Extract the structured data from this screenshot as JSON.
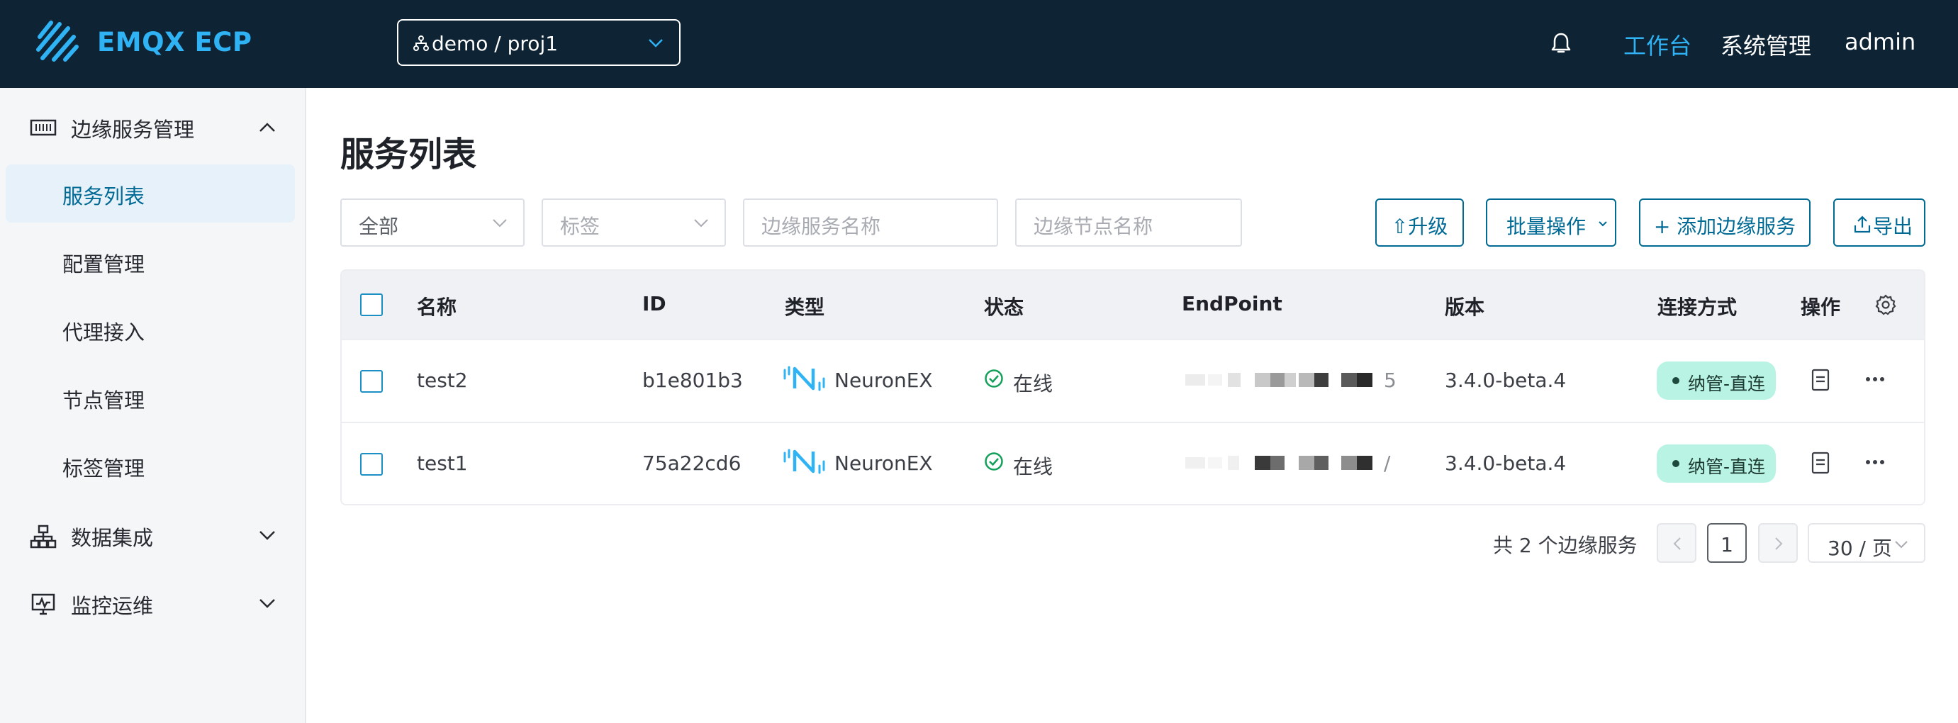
{
  "header": {
    "brand": "EMQX ECP",
    "project_selector": "demo / proj1",
    "nav": {
      "workbench": "工作台",
      "system": "系统管理",
      "user": "admin"
    }
  },
  "sidebar": {
    "groups": [
      {
        "label": "边缘服务管理",
        "expanded": true,
        "icon": "barcode-icon"
      },
      {
        "label": "数据集成",
        "expanded": false,
        "icon": "sitemap-icon"
      },
      {
        "label": "监控运维",
        "expanded": false,
        "icon": "monitor-icon"
      }
    ],
    "items": [
      {
        "label": "服务列表",
        "active": true
      },
      {
        "label": "配置管理",
        "active": false
      },
      {
        "label": "代理接入",
        "active": false
      },
      {
        "label": "节点管理",
        "active": false
      },
      {
        "label": "标签管理",
        "active": false
      }
    ]
  },
  "main": {
    "title": "服务列表",
    "filters": {
      "type_select": "全部",
      "tag_select_placeholder": "标签",
      "service_name_placeholder": "边缘服务名称",
      "node_name_placeholder": "边缘节点名称"
    },
    "actions": {
      "upgrade": "⇧升级",
      "batch": "批量操作",
      "add": "+ 添加边缘服务",
      "export": "导出"
    },
    "table": {
      "columns": [
        "名称",
        "ID",
        "类型",
        "状态",
        "EndPoint",
        "版本",
        "连接方式",
        "操作"
      ],
      "rows": [
        {
          "name": "test2",
          "id": "b1e801b3",
          "type": "NeuronEX",
          "status": "在线",
          "endpoint_trailing": "5",
          "version": "3.4.0-beta.4",
          "connection": "纳管-直连"
        },
        {
          "name": "test1",
          "id": "75a22cd6",
          "type": "NeuronEX",
          "status": "在线",
          "endpoint_trailing": "/",
          "version": "3.4.0-beta.4",
          "connection": "纳管-直连"
        }
      ]
    },
    "pagination": {
      "total_text": "共 2 个边缘服务",
      "current_page": "1",
      "page_size": "30 / 页"
    }
  },
  "colors": {
    "header_bg": "#0e2334",
    "accent": "#2fb3f5",
    "primary": "#006a95",
    "badge_bg": "#b8f3e4",
    "online_green": "#14a05a"
  }
}
